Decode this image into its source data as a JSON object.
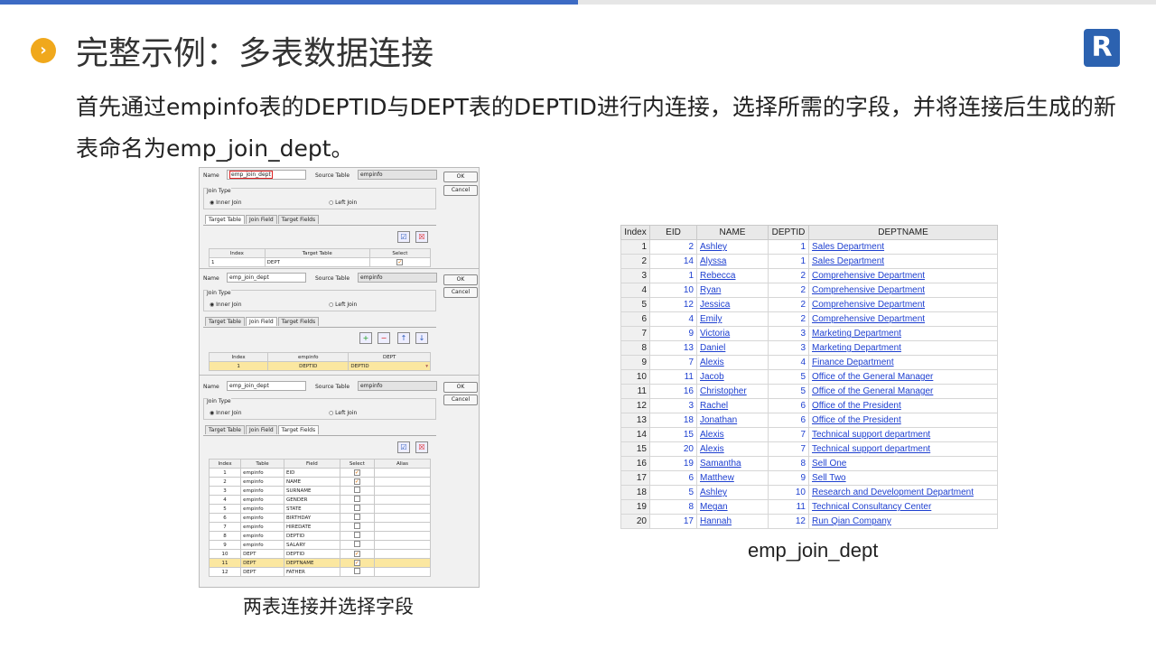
{
  "title": "完整示例：多表数据连接",
  "body": "首先通过empinfo表的DEPTID与DEPT表的DEPTID进行内连接，选择所需的字段，并将连接后生成的新表命名为emp_join_dept。",
  "logo": "R",
  "bullet": "›",
  "caption_left": "两表连接并选择字段",
  "caption_right": "emp_join_dept",
  "dialog": {
    "name_label": "Name",
    "source_label": "Source Table",
    "source_value": "empinfo",
    "name_value_1": "emp_join_dept",
    "name_value": "emp_join_dept",
    "ok": "OK",
    "cancel": "Cancel",
    "join_type": "Join Type",
    "inner": "Inner Join",
    "left": "Left Join",
    "tabs": [
      "Target Table",
      "Join Field",
      "Target Fields"
    ],
    "tt_headers": [
      "Index",
      "Target Table",
      "Select"
    ],
    "tt_row": {
      "index": "1",
      "table": "DEPT"
    },
    "jf_headers": [
      "Index",
      "empinfo",
      "DEPT"
    ],
    "jf_row": {
      "index": "1",
      "left": "DEPTID",
      "right": "DEPTID"
    },
    "tf_headers": [
      "Index",
      "Table",
      "Field",
      "Select",
      "Alias"
    ],
    "tf_rows": [
      [
        "1",
        "empinfo",
        "EID",
        true
      ],
      [
        "2",
        "empinfo",
        "NAME",
        true
      ],
      [
        "3",
        "empinfo",
        "SURNAME",
        false
      ],
      [
        "4",
        "empinfo",
        "GENDER",
        false
      ],
      [
        "5",
        "empinfo",
        "STATE",
        false
      ],
      [
        "6",
        "empinfo",
        "BIRTHDAY",
        false
      ],
      [
        "7",
        "empinfo",
        "HIREDATE",
        false
      ],
      [
        "8",
        "empinfo",
        "DEPTID",
        false
      ],
      [
        "9",
        "empinfo",
        "SALARY",
        false
      ],
      [
        "10",
        "DEPT",
        "DEPTID",
        true
      ],
      [
        "11",
        "DEPT",
        "DEPTNAME",
        true
      ],
      [
        "12",
        "DEPT",
        "FATHER",
        false
      ]
    ]
  },
  "result": {
    "headers": [
      "Index",
      "EID",
      "NAME",
      "DEPTID",
      "DEPTNAME"
    ],
    "rows": [
      [
        "1",
        "2",
        "Ashley",
        "1",
        "Sales Department"
      ],
      [
        "2",
        "14",
        "Alyssa",
        "1",
        "Sales Department"
      ],
      [
        "3",
        "1",
        "Rebecca",
        "2",
        "Comprehensive Department"
      ],
      [
        "4",
        "10",
        "Ryan",
        "2",
        "Comprehensive Department"
      ],
      [
        "5",
        "12",
        "Jessica",
        "2",
        "Comprehensive Department"
      ],
      [
        "6",
        "4",
        "Emily",
        "2",
        "Comprehensive Department"
      ],
      [
        "7",
        "9",
        "Victoria",
        "3",
        "Marketing Department"
      ],
      [
        "8",
        "13",
        "Daniel",
        "3",
        "Marketing Department"
      ],
      [
        "9",
        "7",
        "Alexis",
        "4",
        "Finance Department"
      ],
      [
        "10",
        "11",
        "Jacob",
        "5",
        "Office of the General Manager"
      ],
      [
        "11",
        "16",
        "Christopher",
        "5",
        "Office of the General Manager"
      ],
      [
        "12",
        "3",
        "Rachel",
        "6",
        "Office of the President"
      ],
      [
        "13",
        "18",
        "Jonathan",
        "6",
        "Office of the President"
      ],
      [
        "14",
        "15",
        "Alexis",
        "7",
        "Technical support department"
      ],
      [
        "15",
        "20",
        "Alexis",
        "7",
        "Technical support department"
      ],
      [
        "16",
        "19",
        "Samantha",
        "8",
        "Sell One"
      ],
      [
        "17",
        "6",
        "Matthew",
        "9",
        "Sell Two"
      ],
      [
        "18",
        "5",
        "Ashley",
        "10",
        "Research and Development Department"
      ],
      [
        "19",
        "8",
        "Megan",
        "11",
        "Technical Consultancy Center"
      ],
      [
        "20",
        "17",
        "Hannah",
        "12",
        "Run Qian Company"
      ]
    ]
  }
}
